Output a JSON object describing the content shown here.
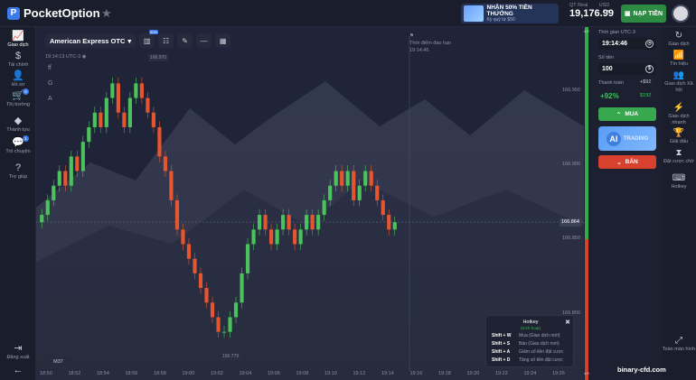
{
  "header": {
    "logo": "PocketOption",
    "promo_title": "NHẬN 50% TIỀN THƯỞNG",
    "promo_sub": "Kỳ quỹ từ $50",
    "balance_label": "QT Real",
    "currency": "USD",
    "balance_value": "19,176.99",
    "deposit_label": "NẠP TIỀN"
  },
  "left_nav": [
    {
      "label": "Giao dịch",
      "icon": "chart-line-icon"
    },
    {
      "label": "Tài chính",
      "icon": "dollar-icon"
    },
    {
      "label": "Hồ sơ",
      "icon": "user-icon"
    },
    {
      "label": "Thị trường",
      "icon": "cart-icon",
      "badge": "6"
    },
    {
      "label": "Thành tựu",
      "icon": "diamond-icon"
    },
    {
      "label": "Trò chuyện",
      "icon": "chat-icon",
      "badge": "1"
    },
    {
      "label": "Trợ giúp",
      "icon": "help-icon"
    }
  ],
  "left_bottom": {
    "logout": "Đăng xuất"
  },
  "right_nav": [
    {
      "label": "Giao dịch",
      "icon": "history-icon"
    },
    {
      "label": "Tín hiệu",
      "icon": "signal-icon"
    },
    {
      "label": "Giao dịch Xã hội",
      "icon": "social-icon"
    },
    {
      "label": "Giao dịch nhanh",
      "icon": "fast-icon"
    },
    {
      "label": "Giải đấu",
      "icon": "trophy-icon"
    },
    {
      "label": "Đặt cược chờ",
      "icon": "hourglass-icon"
    },
    {
      "label": "Hotkey",
      "icon": "keyboard-icon"
    }
  ],
  "right_bottom": {
    "fullscreen": "Toàn màn hình"
  },
  "chart": {
    "asset": "American Express OTC",
    "indicator_badge": "50%",
    "time_label": "19:14:13 UTC-3",
    "side_tools": [
      "ff",
      "G",
      "A"
    ],
    "expire_title": "Thời điểm đáo hạn",
    "expire_time": "19:14:46",
    "price_labels": [
      "166.950",
      "166.900",
      "166.850",
      "166.800"
    ],
    "current_price": "166.864",
    "high_label": "166.970",
    "low_label": "166.779",
    "timeframe": "M37",
    "x_ticks": [
      "18:50",
      "18:52",
      "18:54",
      "18:56",
      "18:58",
      "19:00",
      "19:02",
      "19:04",
      "19:06",
      "19:08",
      "19:10",
      "19:12",
      "19:14",
      "19:16",
      "19:18",
      "19:20",
      "19:22",
      "19:24",
      "19:26"
    ]
  },
  "chart_data": {
    "type": "candlestick",
    "x_start": "18:50",
    "x_end": "19:14",
    "ylim": [
      166.77,
      166.98
    ],
    "current": 166.864,
    "high": 166.97,
    "low": 166.779,
    "close_series": [
      166.87,
      166.88,
      166.89,
      166.9,
      166.89,
      166.91,
      166.9,
      166.92,
      166.93,
      166.94,
      166.93,
      166.95,
      166.96,
      166.94,
      166.93,
      166.95,
      166.96,
      166.95,
      166.94,
      166.93,
      166.91,
      166.9,
      166.88,
      166.86,
      166.85,
      166.84,
      166.83,
      166.82,
      166.81,
      166.8,
      166.79,
      166.79,
      166.8,
      166.81,
      166.83,
      166.85,
      166.86,
      166.87,
      166.86,
      166.85,
      166.86,
      166.87,
      166.86,
      166.85,
      166.86,
      166.87,
      166.86,
      166.87,
      166.88,
      166.89,
      166.9,
      166.89,
      166.9,
      166.88,
      166.89,
      166.9,
      166.89,
      166.88,
      166.87,
      166.86,
      166.865
    ]
  },
  "hotkey": {
    "title": "Hotkey",
    "subtitle": "(Kích hoạt)",
    "rows": [
      {
        "key": "Shift + W",
        "desc": "Mua (Giao dịch mới)"
      },
      {
        "key": "Shift + S",
        "desc": "Bán (Giao dịch mới)"
      },
      {
        "key": "Shift + A",
        "desc": "Giảm số tiền đặt cược"
      },
      {
        "key": "Shift + D",
        "desc": "Tăng số tiền đặt cược"
      }
    ]
  },
  "progress": {
    "top_pct": "60%",
    "bottom_pct": "40%",
    "green_fraction": 0.6
  },
  "trade": {
    "time_label": "Thời gian UTC-3",
    "time_value": "19:14:46",
    "amount_label": "Số tiền",
    "amount_value": "100",
    "payout_label": "Thanh toán",
    "payout_delta": "+$92",
    "payout_pct": "+92%",
    "payout_amount": "$192",
    "buy_label": "MUA",
    "ai_label": "AI",
    "ai_text": "TRADING",
    "sell_label": "BÁN"
  },
  "watermark": "binary-cfd.com"
}
